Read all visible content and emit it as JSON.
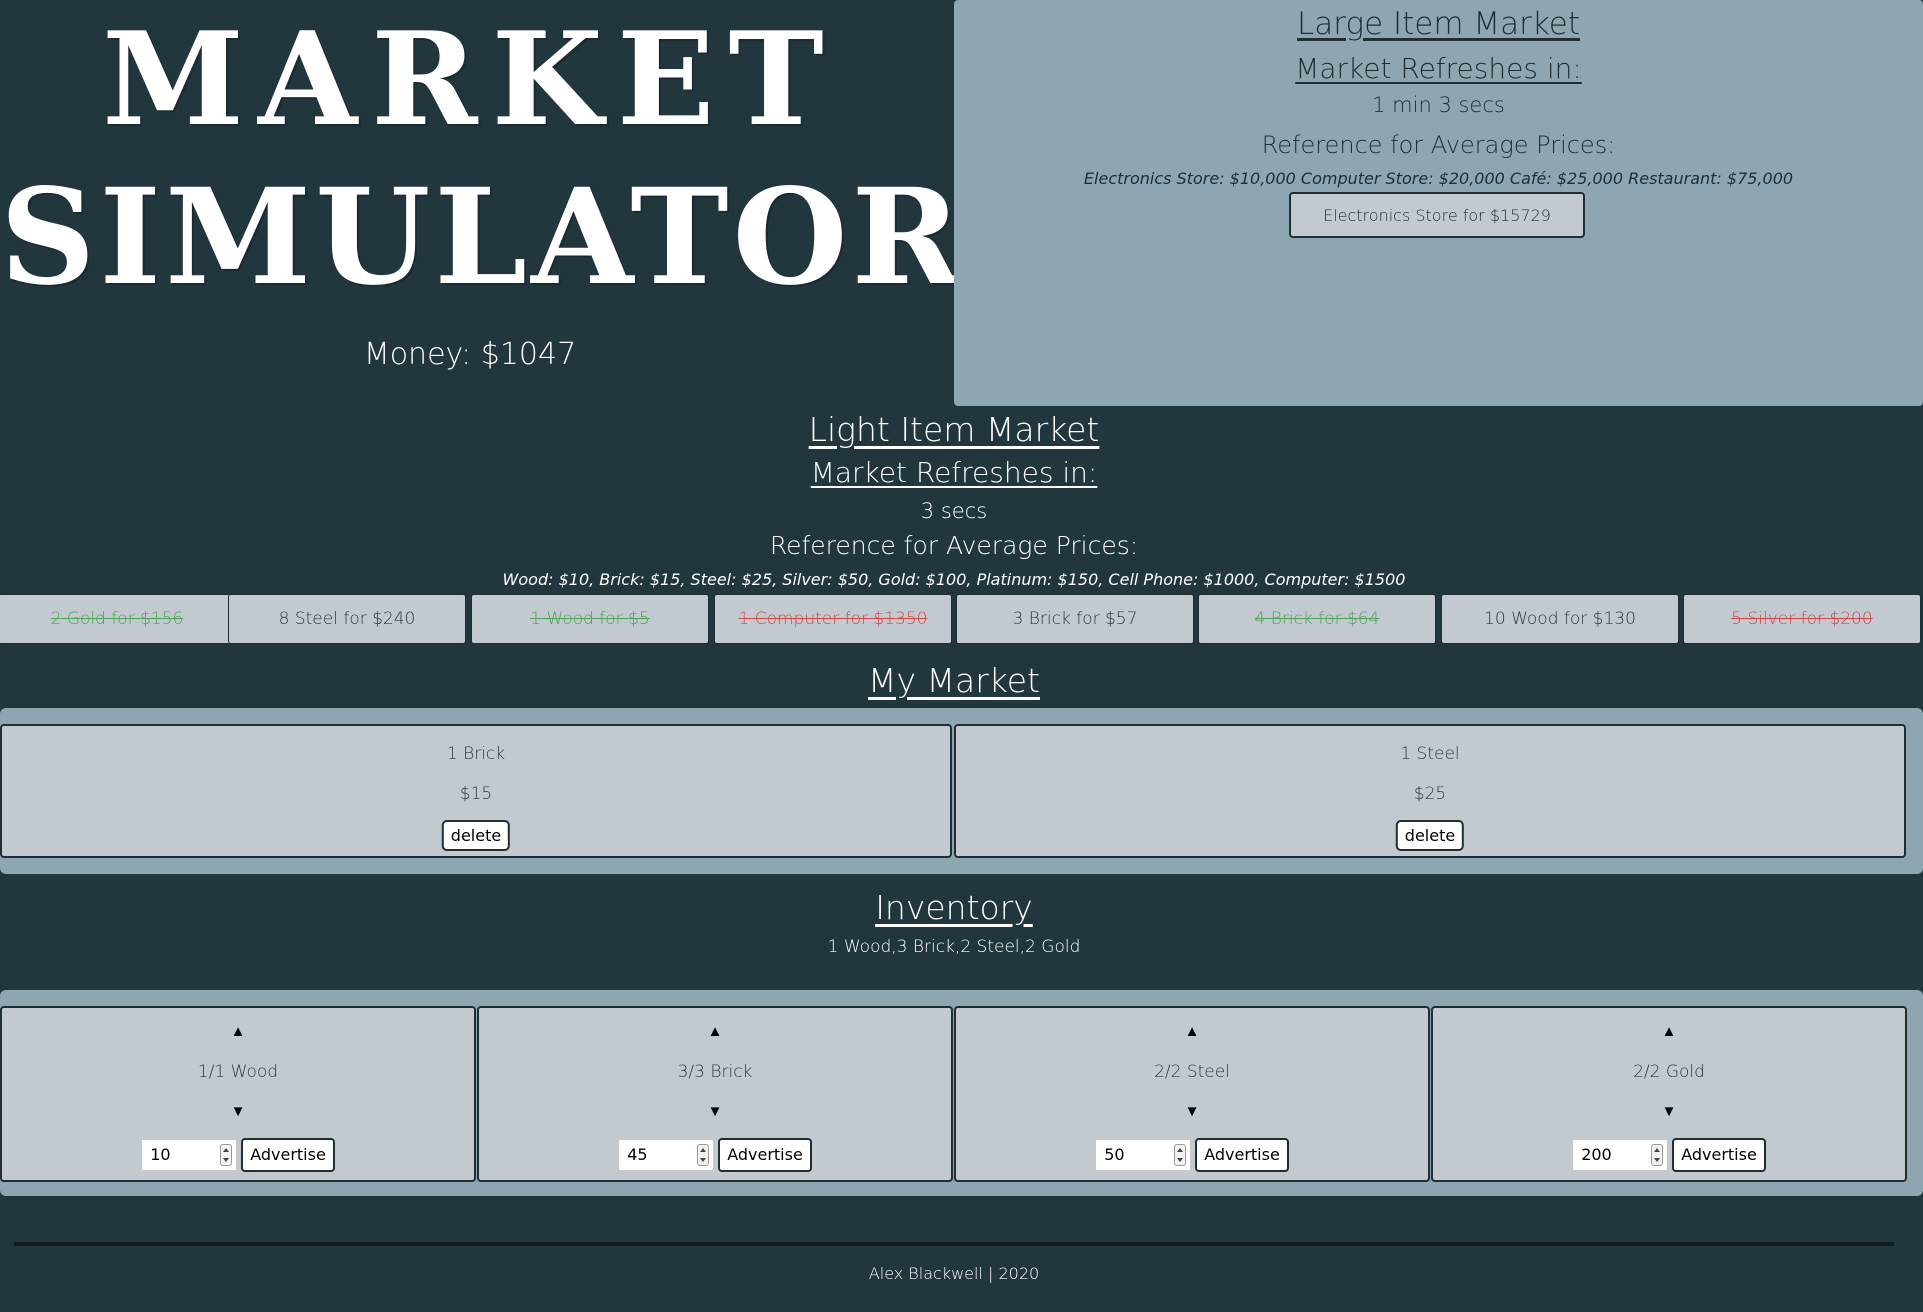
{
  "header": {
    "title_line1": "MARKET",
    "title_line2": "SIMULATOR",
    "money": "Money: $1047"
  },
  "large_market": {
    "title": "Large Item Market",
    "refresh_label": "Market Refreshes in:",
    "timer": "1 min 3 secs",
    "reference_label": "Reference for Average Prices:",
    "reference_prices": "Electronics Store: $10,000 Computer Store: $20,000 Café: $25,000 Restaurant: $75,000",
    "offer_button": "Electronics Store for $15729"
  },
  "light_market": {
    "title": "Light Item Market",
    "refresh_label": "Market Refreshes in:",
    "timer": "3 secs",
    "reference_label": "Reference for Average Prices:",
    "reference_prices": "Wood: $10, Brick: $15, Steel: $25, Silver: $50, Gold: $100, Platinum: $150, Cell Phone: $1000, Computer: $1500",
    "offers": [
      {
        "label": "2 Gold for $156",
        "status": "sold-green"
      },
      {
        "label": "8 Steel for $240",
        "status": "available"
      },
      {
        "label": "1 Wood for $5",
        "status": "sold-green"
      },
      {
        "label": "1 Computer for $1350",
        "status": "sold-red"
      },
      {
        "label": "3 Brick for $57",
        "status": "available"
      },
      {
        "label": "4 Brick for $64",
        "status": "sold-green"
      },
      {
        "label": "10 Wood for $130",
        "status": "available"
      },
      {
        "label": "5 Silver for $200",
        "status": "sold-red"
      }
    ]
  },
  "my_market": {
    "title": "My Market",
    "listings": [
      {
        "name": "1 Brick",
        "price": "$15",
        "delete_label": "delete"
      },
      {
        "name": "1 Steel",
        "price": "$25",
        "delete_label": "delete"
      }
    ]
  },
  "inventory": {
    "title": "Inventory",
    "summary": "1 Wood,3 Brick,2 Steel,2 Gold",
    "items": [
      {
        "count": "1/1 Wood",
        "price_value": "10",
        "advertise_label": "Advertise",
        "up": "▲",
        "down": "▼"
      },
      {
        "count": "3/3 Brick",
        "price_value": "45",
        "advertise_label": "Advertise",
        "up": "▲",
        "down": "▼"
      },
      {
        "count": "2/2 Steel",
        "price_value": "50",
        "advertise_label": "Advertise",
        "up": "▲",
        "down": "▼"
      },
      {
        "count": "2/2 Gold",
        "price_value": "200",
        "advertise_label": "Advertise",
        "up": "▲",
        "down": "▼"
      }
    ]
  },
  "footer": {
    "text": "Alex Blackwell | 2020"
  },
  "colors": {
    "background": "#21373d",
    "panel": "#8da6b1",
    "card": "#c2cad0",
    "sold_green": "#4ea35a",
    "sold_red": "#d24848"
  }
}
